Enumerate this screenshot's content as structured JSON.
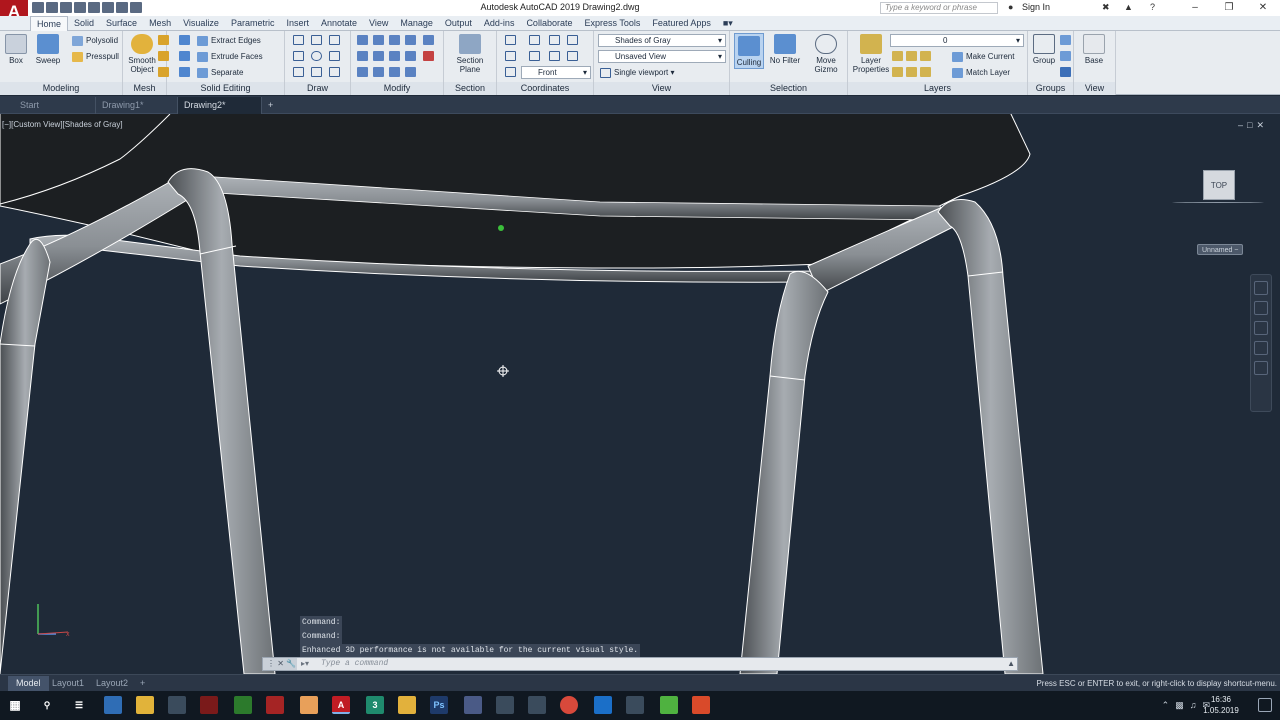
{
  "app": {
    "logo": "A",
    "title": "Autodesk AutoCAD 2019    Drawing2.dwg",
    "search_placeholder": "Type a keyword or phrase",
    "sign_in": "Sign In"
  },
  "ribbon_tabs": [
    "Home",
    "Solid",
    "Surface",
    "Mesh",
    "Visualize",
    "Parametric",
    "Insert",
    "Annotate",
    "View",
    "Manage",
    "Output",
    "Add-ins",
    "Collaborate",
    "Express Tools",
    "Featured Apps"
  ],
  "panels": {
    "modeling": {
      "label": "Modeling",
      "box": "Box",
      "sweep": "Sweep",
      "polysolid": "Polysolid",
      "presspull": "Presspull"
    },
    "mesh": {
      "label": "Mesh",
      "smooth_object": "Smooth Object"
    },
    "solid_editing": {
      "label": "Solid Editing",
      "extract_edges": "Extract Edges",
      "extrude_faces": "Extrude Faces",
      "separate": "Separate"
    },
    "draw": {
      "label": "Draw"
    },
    "modify": {
      "label": "Modify"
    },
    "section": {
      "label": "Section",
      "section_plane": "Section Plane"
    },
    "coordinates": {
      "label": "Coordinates",
      "ucs_front": "Front"
    },
    "view": {
      "label": "View",
      "visual_style": "Shades of Gray",
      "saved_view": "Unsaved View",
      "viewport_config": "Single viewport"
    },
    "selection": {
      "label": "Selection",
      "culling": "Culling",
      "no_filter": "No Filter",
      "move_gizmo": "Move Gizmo"
    },
    "layers": {
      "label": "Layers",
      "layer_properties": "Layer Properties",
      "current_layer": "0",
      "make_current": "Make Current",
      "match_layer": "Match Layer"
    },
    "groups": {
      "label": "Groups",
      "group": "Group"
    },
    "view2": {
      "label": "View",
      "base": "Base"
    }
  },
  "doc_tabs": [
    "Start",
    "Drawing1*",
    "Drawing2*"
  ],
  "viewport": {
    "label": "[−][Custom View][Shades of Gray]",
    "viewcube_face": "TOP",
    "wcs_menu": "Unnamed −"
  },
  "command": {
    "history": [
      "Command:",
      "Command:",
      "Enhanced 3D performance is not available for the current visual style."
    ],
    "placeholder": "Type a command"
  },
  "layout_tabs": [
    "Model",
    "Layout1",
    "Layout2"
  ],
  "status_message": "Press ESC or ENTER to exit, or right-click to display shortcut-menu.",
  "clock": {
    "time": "16:36",
    "date": "1.05.2019"
  },
  "colors": {
    "viewport_bg": "#1f2a38",
    "tube_fill": "#8c9196",
    "seat_fill": "#1c1f22",
    "outline": "#ffffff",
    "accent_red": "#b0161d"
  }
}
